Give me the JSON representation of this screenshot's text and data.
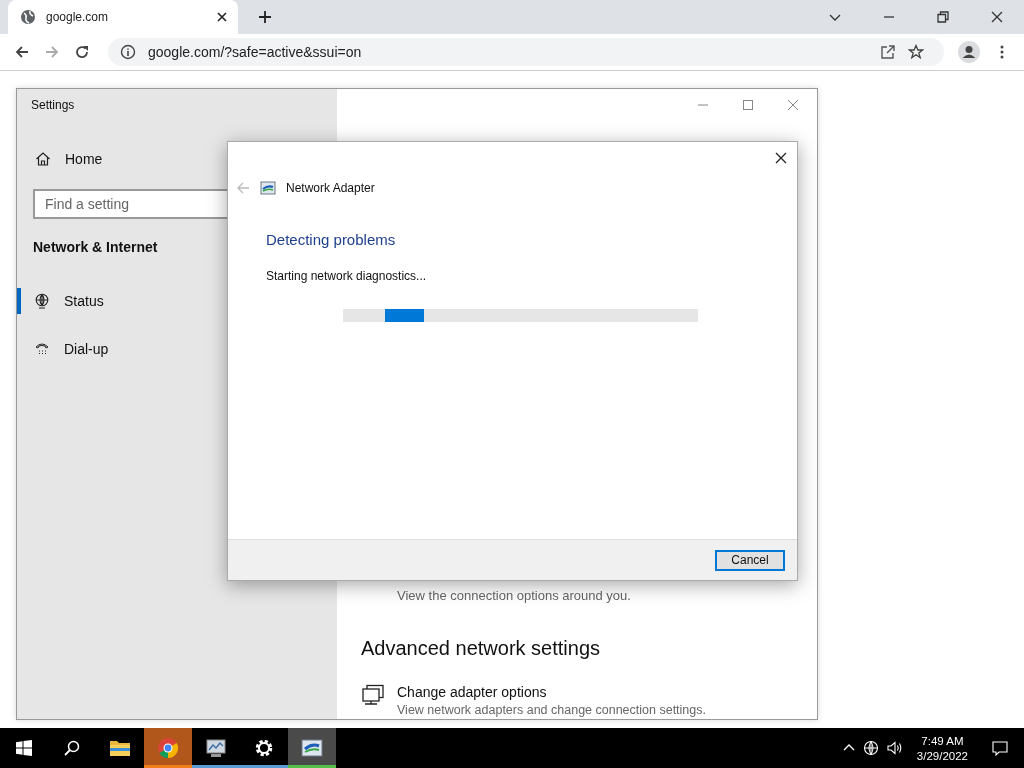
{
  "browser": {
    "tab": {
      "title": "google.com"
    },
    "address": "google.com/?safe=active&ssui=on"
  },
  "settings": {
    "title": "Settings",
    "home": "Home",
    "search": {
      "placeholder": "Find a setting"
    },
    "section": "Network & Internet",
    "nav": [
      {
        "label": "Status",
        "kind": "globe",
        "selected": true
      },
      {
        "label": "Dial-up",
        "kind": "phone",
        "selected": false
      }
    ],
    "partial_text": "View the connection options around you.",
    "heading": "Advanced network settings",
    "options": [
      {
        "title": "Change adapter options",
        "desc": "View network adapters and change connection settings."
      }
    ]
  },
  "dialog": {
    "title": "Network Adapter",
    "heading": "Detecting problems",
    "status": "Starting network diagnostics...",
    "button": "Cancel",
    "progress": {
      "level": 0.11
    }
  },
  "taskbar": {
    "apps": [
      {
        "kind": "folder",
        "selected": false
      },
      {
        "kind": "chrome",
        "color": "#f07f1c",
        "selected": true
      },
      {
        "kind": "monitor",
        "color": "#5b9bd5",
        "selected": false
      },
      {
        "kind": "gear",
        "color": "#5b9bd5",
        "selected": false
      },
      {
        "kind": "adapter",
        "color": "#54c04a",
        "selected": true
      }
    ],
    "time": "7:49 AM",
    "date": "3/29/2022"
  }
}
